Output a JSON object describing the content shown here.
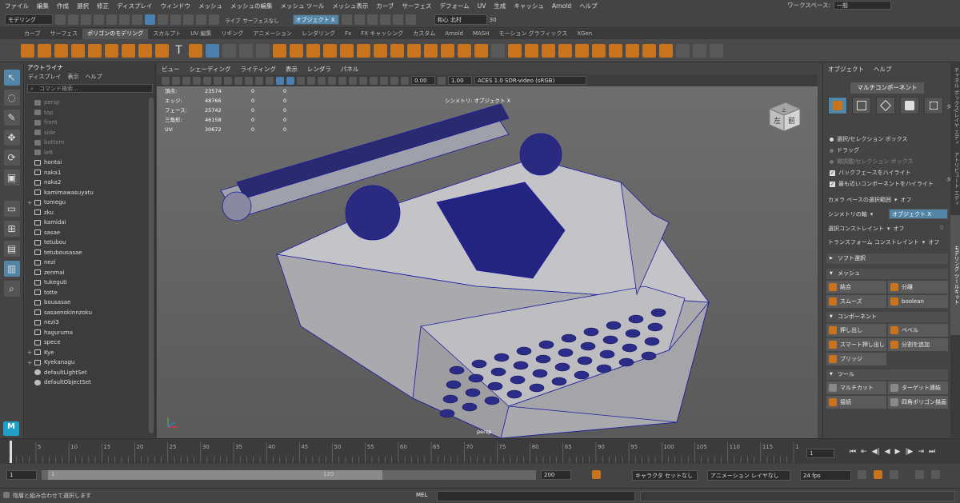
{
  "menubar": {
    "items": [
      "ファイル",
      "編集",
      "作成",
      "選択",
      "修正",
      "ディスプレイ",
      "ウィンドウ",
      "メッシュ",
      "メッシュの編集",
      "メッシュ ツール",
      "メッシュ表示",
      "カーブ",
      "サーフェス",
      "デフォーム",
      "UV",
      "生成",
      "キャッシュ",
      "Arnold",
      "ヘルプ"
    ],
    "workspace_label": "ワークスペース:",
    "workspace_value": "一般"
  },
  "statusline": {
    "mode": "モデリング",
    "live_label": "ライブ",
    "live_value": "サーフェスなし",
    "symmetry": "オブジェクト X",
    "user": "和心 北村",
    "counter": "30"
  },
  "shelf_tabs": [
    "カーブ",
    "サーフェス",
    "ポリゴンのモデリング",
    "スカルプト",
    "UV 編集",
    "リギング",
    "アニメーション",
    "レンダリング",
    "Fx",
    "FX キャッシング",
    "カスタム",
    "Arnold",
    "MASH",
    "モーション グラフィックス",
    "XGen"
  ],
  "shelf_active": "ポリゴンのモデリング",
  "outliner": {
    "title": "アウトライナ",
    "menus": [
      "ディスプレイ",
      "表示",
      "ヘルプ"
    ],
    "search_placeholder": "コマンド検索...",
    "items": [
      {
        "label": "persp",
        "kind": "cam",
        "exp": ""
      },
      {
        "label": "top",
        "kind": "cam",
        "exp": ""
      },
      {
        "label": "front",
        "kind": "cam",
        "exp": ""
      },
      {
        "label": "side",
        "kind": "cam",
        "exp": ""
      },
      {
        "label": "bottom",
        "kind": "cam",
        "exp": ""
      },
      {
        "label": "left",
        "kind": "cam",
        "exp": ""
      },
      {
        "label": "hontai",
        "kind": "grp",
        "exp": ""
      },
      {
        "label": "naka1",
        "kind": "grp",
        "exp": ""
      },
      {
        "label": "naka2",
        "kind": "grp",
        "exp": ""
      },
      {
        "label": "kamimawasuyatu",
        "kind": "grp",
        "exp": ""
      },
      {
        "label": "tomegu",
        "kind": "grp",
        "exp": "+"
      },
      {
        "label": "zku",
        "kind": "grp",
        "exp": ""
      },
      {
        "label": "kamidai",
        "kind": "grp",
        "exp": ""
      },
      {
        "label": "sasae",
        "kind": "grp",
        "exp": ""
      },
      {
        "label": "tetubou",
        "kind": "grp",
        "exp": ""
      },
      {
        "label": "tetubousasae",
        "kind": "grp",
        "exp": ""
      },
      {
        "label": "nezi",
        "kind": "grp",
        "exp": ""
      },
      {
        "label": "zenmai",
        "kind": "grp",
        "exp": ""
      },
      {
        "label": "tukeguti",
        "kind": "grp",
        "exp": ""
      },
      {
        "label": "totte",
        "kind": "grp",
        "exp": ""
      },
      {
        "label": "bousasae",
        "kind": "grp",
        "exp": ""
      },
      {
        "label": "sasaenokinnzoku",
        "kind": "grp",
        "exp": ""
      },
      {
        "label": "nezi3",
        "kind": "grp",
        "exp": ""
      },
      {
        "label": "haguruma",
        "kind": "grp",
        "exp": ""
      },
      {
        "label": "spece",
        "kind": "grp",
        "exp": ""
      },
      {
        "label": "Kye",
        "kind": "grp",
        "exp": "+"
      },
      {
        "label": "Kyekanagu",
        "kind": "grp",
        "exp": "+"
      },
      {
        "label": "defaultLightSet",
        "kind": "set",
        "exp": ""
      },
      {
        "label": "defaultObjectSet",
        "kind": "set",
        "exp": ""
      }
    ]
  },
  "viewport": {
    "menus": [
      "ビュー",
      "シェーディング",
      "ライティング",
      "表示",
      "レンダラ",
      "パネル"
    ],
    "val1": "0.00",
    "val2": "1.00",
    "colorspace": "ACES 1.0 SDR-video (sRGB)",
    "symmetry_label": "シンメトリ: オブジェクト X",
    "camera": "persp",
    "hud": [
      {
        "k": "頂点:",
        "v": "23574",
        "a": "0",
        "b": "0"
      },
      {
        "k": "エッジ:",
        "v": "48766",
        "a": "0",
        "b": "0"
      },
      {
        "k": "フェース:",
        "v": "25742",
        "a": "0",
        "b": "0"
      },
      {
        "k": "三角形:",
        "v": "46158",
        "a": "0",
        "b": "0"
      },
      {
        "k": "UV:",
        "v": "30672",
        "a": "0",
        "b": "0"
      }
    ],
    "viewcube_left": "左",
    "viewcube_front": "前",
    "viewcube_top": "上"
  },
  "right_panel": {
    "menus": [
      "オブジェクト",
      "ヘルプ"
    ],
    "multicomponent": "マルチコンポーネント",
    "opt_select": "選択/セレクション ボックス",
    "opt_drag": "ドラッグ",
    "opt_tweak": "微調整/セレクション ボックス",
    "opt_backface": "バックフェースをハイライト",
    "opt_nearest": "最も近いコンポーネントをハイライト",
    "camera_based": "カメラ ベースの選択範囲",
    "camera_based_val": "オフ",
    "sym_axis": "シンメトリの軸",
    "sym_axis_val": "オブジェクト X",
    "select_constraint": "選択コンストレイント",
    "select_constraint_val": "オフ",
    "select_constraint_num": "0",
    "transform_constraint": "トランスフォーム コンストレイント",
    "transform_constraint_val": "オフ",
    "soft_select": "ソフト選択",
    "mesh": "メッシュ",
    "combine": "結合",
    "separate": "分離",
    "smooth": "スムーズ",
    "boolean": "boolean",
    "components": "コンポーネント",
    "extrude": "押し出し",
    "bevel": "ベベル",
    "smart_extrude": "スマート押し出し",
    "add_divisions": "分割を追加",
    "bridge": "ブリッジ",
    "tools": "ツール",
    "multicut": "マルチカット",
    "target_weld": "ターゲット連結",
    "connect": "接続",
    "quad_draw": "四角ポリゴン描画"
  },
  "vertical_tabs": [
    "チャネル ボックス/レイヤ エディタ",
    "アトリビュート エディタ",
    "モデリング ツールキット"
  ],
  "timeline": {
    "ticks": [
      "5",
      "10",
      "15",
      "20",
      "25",
      "30",
      "35",
      "40",
      "45",
      "50",
      "55",
      "60",
      "65",
      "70",
      "75",
      "80",
      "85",
      "90",
      "95",
      "100",
      "105",
      "110",
      "115",
      "120"
    ],
    "current_frame": "1",
    "current_frame_fraction": 0.0
  },
  "range": {
    "start": "1",
    "inner_start": "1",
    "inner_end": "120",
    "end": "200",
    "character_set": "キャラクタ セットなし",
    "anim_layer": "アニメーション レイヤなし",
    "fps": "24 fps"
  },
  "helpline": {
    "text": "階層と組み合わせて選択します",
    "mel": "MEL"
  },
  "colors": {
    "accent_blue": "#5285a6",
    "orange_icon": "#c9741c",
    "wire_blue": "#1a1aa0"
  }
}
